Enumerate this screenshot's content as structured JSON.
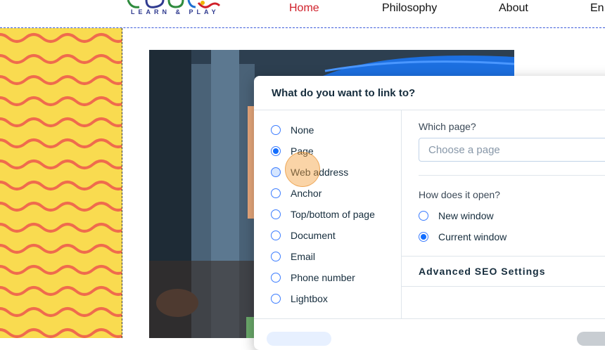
{
  "header": {
    "logo_tagline": "LEARN & PLAY",
    "nav": [
      "Home",
      "Philosophy",
      "About",
      "En"
    ],
    "active_nav": "Home"
  },
  "dialog": {
    "title": "What do you want to link to?",
    "link_types": [
      {
        "label": "None",
        "checked": false
      },
      {
        "label": "Page",
        "checked": true
      },
      {
        "label": "Web address",
        "checked": false
      },
      {
        "label": "Anchor",
        "checked": false
      },
      {
        "label": "Top/bottom of page",
        "checked": false
      },
      {
        "label": "Document",
        "checked": false
      },
      {
        "label": "Email",
        "checked": false
      },
      {
        "label": "Phone number",
        "checked": false
      },
      {
        "label": "Lightbox",
        "checked": false
      }
    ],
    "which_page_label": "Which page?",
    "page_select_placeholder": "Choose a page",
    "opens_label": "How does it open?",
    "open_options": [
      {
        "label": "New window",
        "checked": false
      },
      {
        "label": "Current window",
        "checked": true
      }
    ],
    "seo_label": "Advanced SEO Settings"
  },
  "colors": {
    "accent": "#116dff",
    "active_nav": "#d0202a",
    "strip_yellow": "#f9db50",
    "wave_red": "#ef6b4d"
  },
  "icons": {
    "select_chevron": "chevron-down-icon"
  }
}
